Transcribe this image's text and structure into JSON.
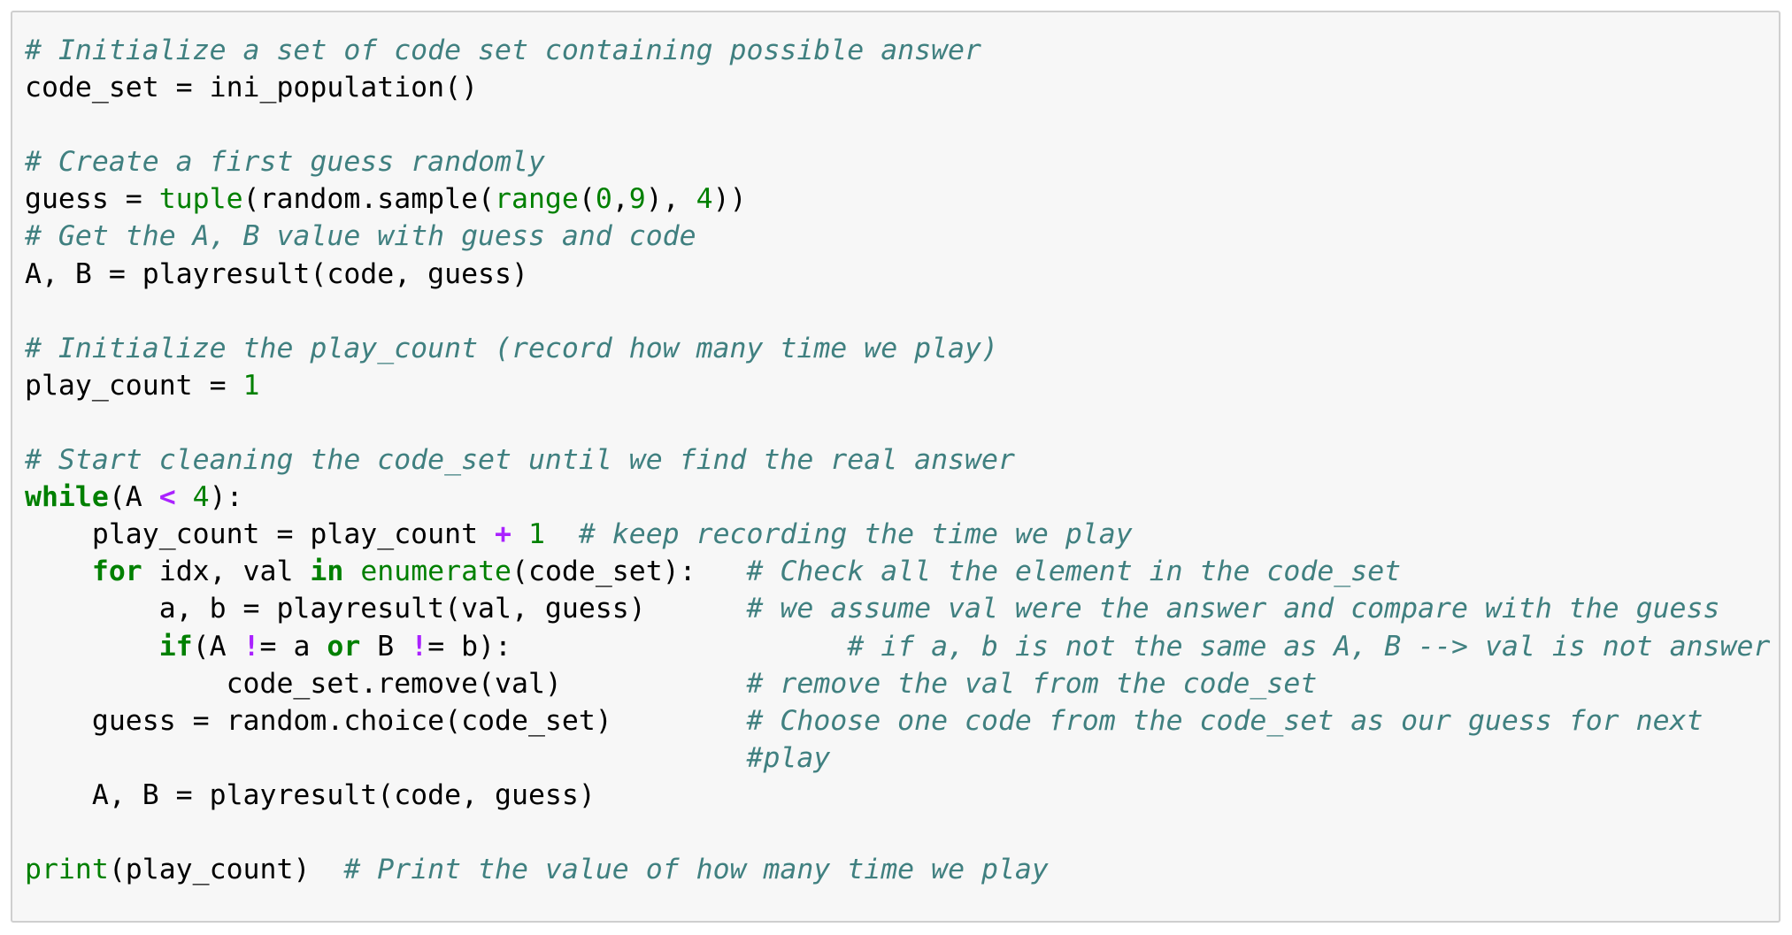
{
  "colors": {
    "background": "#f7f7f7",
    "border": "#cfcfcf",
    "comment": "#408080",
    "keyword": "#008000",
    "builtin": "#008000",
    "number": "#008000",
    "operator": "#aa22ff",
    "text": "#000000"
  },
  "code_lines": [
    [
      {
        "t": "c",
        "v": "# Initialize a set of code set containing possible answer"
      }
    ],
    [
      {
        "t": "p",
        "v": "code_set = ini_population()"
      }
    ],
    [],
    [
      {
        "t": "c",
        "v": "# Create a first guess randomly"
      }
    ],
    [
      {
        "t": "p",
        "v": "guess = "
      },
      {
        "t": "b",
        "v": "tuple"
      },
      {
        "t": "p",
        "v": "(random.sample("
      },
      {
        "t": "b",
        "v": "range"
      },
      {
        "t": "p",
        "v": "("
      },
      {
        "t": "n",
        "v": "0"
      },
      {
        "t": "p",
        "v": ","
      },
      {
        "t": "n",
        "v": "9"
      },
      {
        "t": "p",
        "v": "), "
      },
      {
        "t": "n",
        "v": "4"
      },
      {
        "t": "p",
        "v": "))"
      }
    ],
    [
      {
        "t": "c",
        "v": "# Get the A, B value with guess and code"
      }
    ],
    [
      {
        "t": "p",
        "v": "A, B = playresult(code, guess)"
      }
    ],
    [],
    [
      {
        "t": "c",
        "v": "# Initialize the play_count (record how many time we play)"
      }
    ],
    [
      {
        "t": "p",
        "v": "play_count = "
      },
      {
        "t": "n",
        "v": "1"
      }
    ],
    [],
    [
      {
        "t": "c",
        "v": "# Start cleaning the code_set until we find the real answer"
      }
    ],
    [
      {
        "t": "k",
        "v": "while"
      },
      {
        "t": "p",
        "v": "(A "
      },
      {
        "t": "o",
        "v": "<"
      },
      {
        "t": "p",
        "v": " "
      },
      {
        "t": "n",
        "v": "4"
      },
      {
        "t": "p",
        "v": "):"
      }
    ],
    [
      {
        "t": "p",
        "v": "    play_count = play_count "
      },
      {
        "t": "o",
        "v": "+"
      },
      {
        "t": "p",
        "v": " "
      },
      {
        "t": "n",
        "v": "1"
      },
      {
        "t": "p",
        "v": "  "
      },
      {
        "t": "c",
        "v": "# keep recording the time we play"
      }
    ],
    [
      {
        "t": "p",
        "v": "    "
      },
      {
        "t": "k",
        "v": "for"
      },
      {
        "t": "p",
        "v": " idx, val "
      },
      {
        "t": "k",
        "v": "in"
      },
      {
        "t": "p",
        "v": " "
      },
      {
        "t": "b",
        "v": "enumerate"
      },
      {
        "t": "p",
        "v": "(code_set):   "
      },
      {
        "t": "c",
        "v": "# Check all the element in the code_set"
      }
    ],
    [
      {
        "t": "p",
        "v": "        a, b = playresult(val, guess)      "
      },
      {
        "t": "c",
        "v": "# we assume val were the answer and compare with the guess"
      }
    ],
    [
      {
        "t": "p",
        "v": "        "
      },
      {
        "t": "k",
        "v": "if"
      },
      {
        "t": "p",
        "v": "(A "
      },
      {
        "t": "o",
        "v": "!"
      },
      {
        "t": "p",
        "v": "= a "
      },
      {
        "t": "k",
        "v": "or"
      },
      {
        "t": "p",
        "v": " B "
      },
      {
        "t": "o",
        "v": "!"
      },
      {
        "t": "p",
        "v": "= b):                    "
      },
      {
        "t": "c",
        "v": "# if a, b is not the same as A, B --> val is not answer"
      }
    ],
    [
      {
        "t": "p",
        "v": "            code_set.remove(val)           "
      },
      {
        "t": "c",
        "v": "# remove the val from the code_set"
      }
    ],
    [
      {
        "t": "p",
        "v": "    guess = random.choice(code_set)        "
      },
      {
        "t": "c",
        "v": "# Choose one code from the code_set as our guess for next"
      }
    ],
    [
      {
        "t": "p",
        "v": "                                           "
      },
      {
        "t": "c",
        "v": "#play"
      }
    ],
    [
      {
        "t": "p",
        "v": "    A, B = playresult(code, guess)"
      }
    ],
    [],
    [
      {
        "t": "b",
        "v": "print"
      },
      {
        "t": "p",
        "v": "(play_count)  "
      },
      {
        "t": "c",
        "v": "# Print the value of how many time we play"
      }
    ]
  ]
}
